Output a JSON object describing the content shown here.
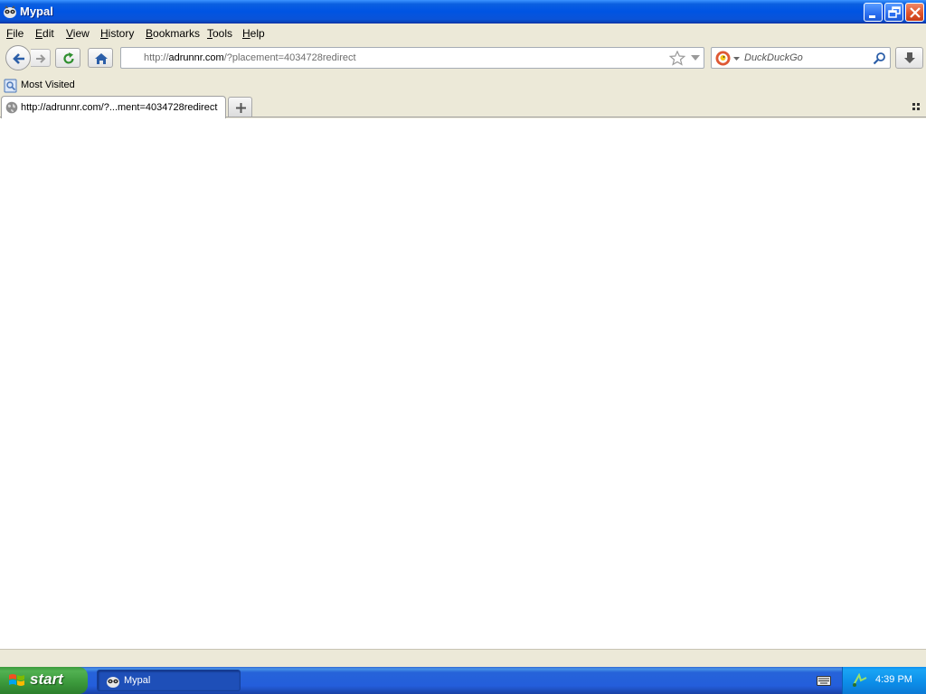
{
  "window": {
    "title": "Mypal",
    "minimize_icon": "minimize-icon",
    "restore_icon": "restore-icon",
    "close_icon": "close-icon"
  },
  "menu": {
    "items": [
      {
        "label": "File",
        "underline": "F",
        "rest": "ile"
      },
      {
        "label": "Edit",
        "underline": "E",
        "rest": "dit"
      },
      {
        "label": "View",
        "underline": "V",
        "rest": "iew"
      },
      {
        "label": "History",
        "underline": "H",
        "rest": "istory"
      },
      {
        "label": "Bookmarks",
        "underline": "B",
        "rest": "ookmarks"
      },
      {
        "label": "Tools",
        "underline": "T",
        "rest": "ools"
      },
      {
        "label": "Help",
        "underline": "H",
        "rest": "elp"
      }
    ]
  },
  "nav": {
    "url_scheme": "http://",
    "url_host": "adrunnr.com",
    "url_rest": "/?placement=4034728redirect",
    "search_placeholder": "DuckDuckGo"
  },
  "bookmarks": {
    "items": [
      {
        "label": "Most Visited"
      }
    ]
  },
  "tabs": {
    "items": [
      {
        "label": "http://adrunnr.com/?...ment=4034728redirect",
        "active": true
      }
    ]
  },
  "taskbar": {
    "start_label": "start",
    "tasks": [
      {
        "label": "Mypal"
      }
    ],
    "clock": "4:39 PM"
  },
  "colors": {
    "titlebar": "#0054e3",
    "start": "#3d9b3d",
    "tray": "#0c8de8"
  }
}
